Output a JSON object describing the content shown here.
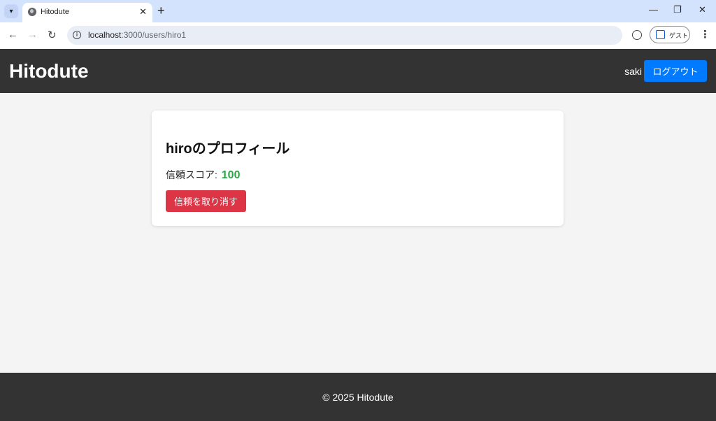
{
  "browser": {
    "tab_title": "Hitodute",
    "url_host": "localhost",
    "url_path": ":3000/users/hiro1",
    "profile_label": "ゲスト",
    "icons": {
      "tab_search": "chevron-down-icon",
      "favicon": "globe-icon",
      "tab_close": "close-icon",
      "new_tab": "plus-icon",
      "back": "back-arrow-icon",
      "forward": "forward-arrow-icon",
      "reload": "reload-icon",
      "site_info": "info-icon",
      "extension": "extension-icon",
      "profile": "profile-icon",
      "menu": "kebab-menu-icon"
    }
  },
  "header": {
    "brand": "Hitodute",
    "username": "saki",
    "logout_label": "ログアウト"
  },
  "profile": {
    "title": "hiroのプロフィール",
    "score_label": "信頼スコア:",
    "score_value": "100",
    "revoke_label": "信頼を取り消す"
  },
  "footer": {
    "text": "© 2025 Hitodute"
  },
  "colors": {
    "header_bg": "#333333",
    "primary": "#007bff",
    "danger": "#dc3545",
    "success": "#28a745",
    "page_bg": "#f4f4f4"
  }
}
